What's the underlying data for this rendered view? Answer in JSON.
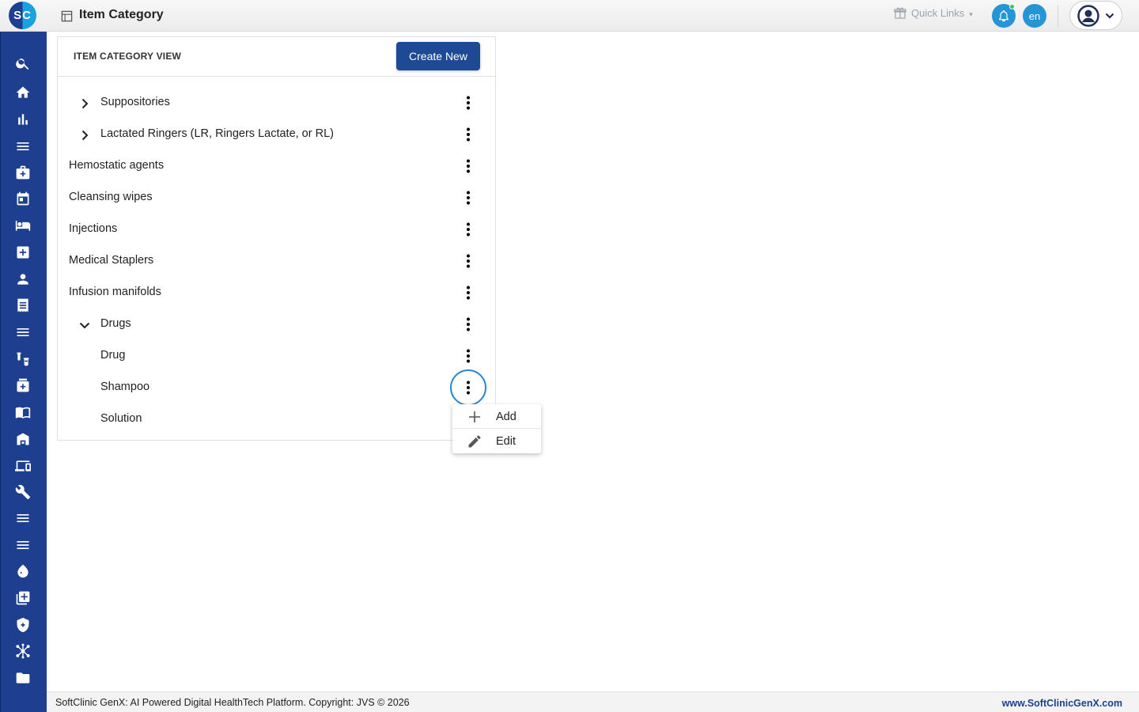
{
  "app": {
    "logo_text": "SC",
    "page_title": "Item Category"
  },
  "header": {
    "quick_links_label": "Quick Links",
    "language_label": "en"
  },
  "card": {
    "title": "ITEM CATEGORY VIEW",
    "create_button_label": "Create New"
  },
  "tree": [
    {
      "label": "Suppositories",
      "level": 1,
      "expander": "collapsed"
    },
    {
      "label": "Lactated Ringers (LR, Ringers Lactate, or RL)",
      "level": 1,
      "expander": "collapsed"
    },
    {
      "label": "Hemostatic agents",
      "level": 0,
      "expander": "none"
    },
    {
      "label": "Cleansing wipes",
      "level": 0,
      "expander": "none"
    },
    {
      "label": "Injections",
      "level": 0,
      "expander": "none"
    },
    {
      "label": "Medical Staplers",
      "level": 0,
      "expander": "none"
    },
    {
      "label": "Infusion manifolds",
      "level": 0,
      "expander": "none"
    },
    {
      "label": "Drugs",
      "level": 1,
      "expander": "expanded"
    },
    {
      "label": "Drug",
      "level": 2,
      "expander": "none"
    },
    {
      "label": "Shampoo",
      "level": 2,
      "expander": "none",
      "menu_open": true
    },
    {
      "label": "Solution",
      "level": 2,
      "expander": "none",
      "kebab_hidden": true
    }
  ],
  "context_menu": {
    "items": [
      {
        "label": "Add",
        "icon": "plus-icon"
      },
      {
        "label": "Edit",
        "icon": "pencil-icon"
      }
    ]
  },
  "footer": {
    "left_text": "SoftClinic GenX: AI Powered Digital HealthTech Platform. Copyright: JVS © 2026",
    "right_text": "www.SoftClinicGenX.com"
  },
  "colors": {
    "sidebar": "#1e3f8f",
    "primary_button": "#1e4a95",
    "accent_blue": "#2595d5",
    "focus_ring": "#2d86d4"
  }
}
